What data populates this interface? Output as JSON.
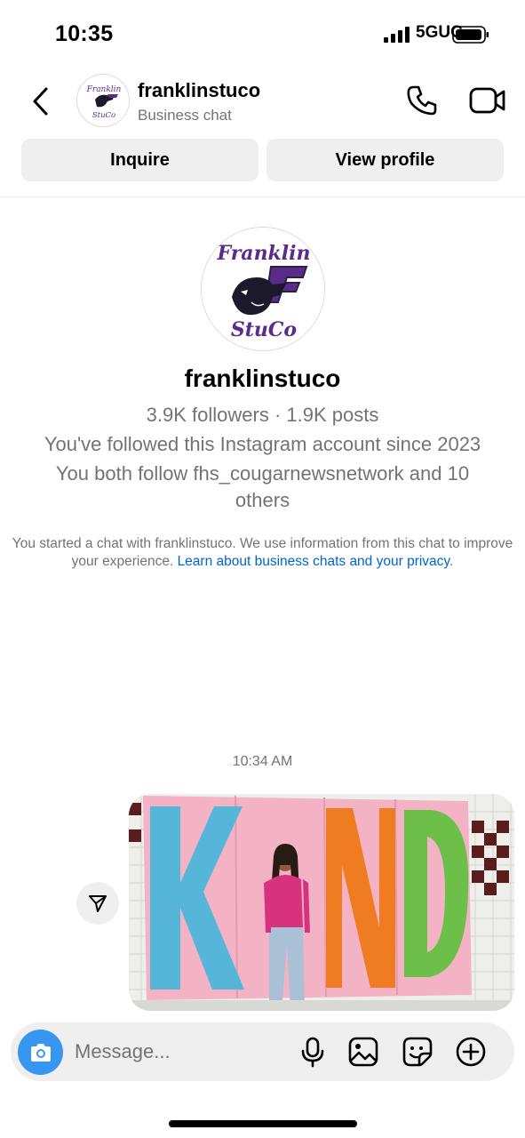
{
  "status_bar": {
    "time": "10:35",
    "network": "5GUC"
  },
  "header": {
    "username": "franklinstuco",
    "subtitle": "Business chat",
    "icons": {
      "back": "chevron-left-icon",
      "call": "phone-icon",
      "video": "video-camera-icon"
    }
  },
  "actions": {
    "inquire_label": "Inquire",
    "view_profile_label": "View profile"
  },
  "profile": {
    "logo_text_top": "Franklin",
    "logo_text_bottom": "StuCo",
    "username": "franklinstuco",
    "stats": "3.9K followers · 1.9K posts",
    "followed_since": "You've followed this Instagram account since 2023",
    "mutual": "You both follow fhs_cougarnewsnetwork and 10 others"
  },
  "notice": {
    "text": "You started a chat with franklinstuco. We use information from this chat to improve your experience. ",
    "link": "Learn about business chats and your privacy",
    "end": "."
  },
  "chat": {
    "timestamp": "10:34 AM",
    "shared_photo": {
      "letters": [
        "K",
        "I",
        "N",
        "D"
      ],
      "colors": {
        "K": "#55b6d9",
        "N": "#f07c22",
        "D": "#6cc04a",
        "paper": "#f3b3c4"
      }
    }
  },
  "composer": {
    "placeholder": "Message...",
    "accent": "#3797f0",
    "icons": [
      "camera-icon",
      "microphone-icon",
      "gallery-icon",
      "sticker-icon",
      "plus-icon"
    ]
  }
}
